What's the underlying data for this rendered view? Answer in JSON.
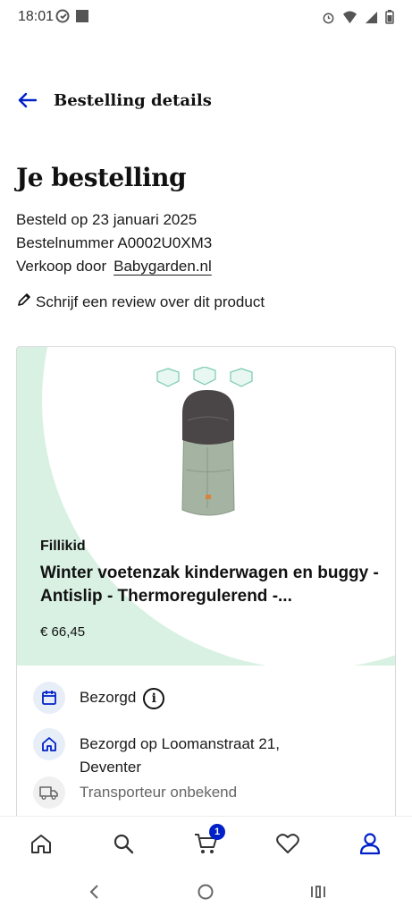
{
  "status_bar": {
    "time": "18:01"
  },
  "topbar": {
    "title": "Bestelling details"
  },
  "order": {
    "heading": "Je bestelling",
    "ordered_on": "Besteld op 23 januari 2025",
    "order_number": "Bestelnummer A0002U0XM3",
    "seller_label": "Verkoop door",
    "seller_name": "Babygarden.nl",
    "review_link": "Schrijf een review over dit product"
  },
  "product": {
    "brand": "Fillikid",
    "title": "Winter voetenzak kinderwagen en buggy - Antislip - Thermoregulerend -...",
    "price": "€ 66,45"
  },
  "delivery": {
    "status": "Bezorgd",
    "address": "Bezorgd op Loomanstraat 21, Deventer",
    "carrier": "Transporteur onbekend"
  },
  "bottom_nav": {
    "cart_count": "1"
  },
  "colors": {
    "accent": "#0020c8",
    "hero_bg": "#d8f1e2",
    "icon_circle": "#e8eef8"
  }
}
